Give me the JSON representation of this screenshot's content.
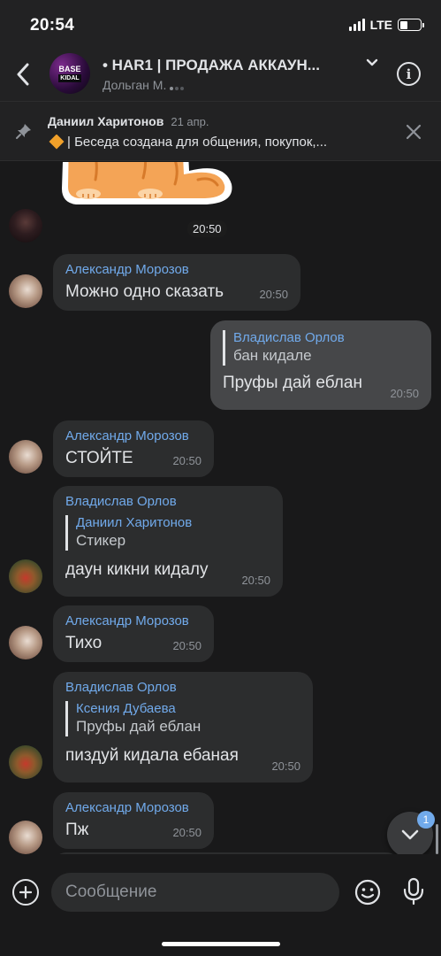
{
  "status_bar": {
    "time": "20:54",
    "network": "LTE",
    "battery_percent": 40
  },
  "header": {
    "avatar_line1": "BASE",
    "avatar_line2": "KIDAL",
    "title": "• HAR1 | ПРОДАЖА АККАУН...",
    "subtitle": "Дольган М."
  },
  "pinned": {
    "author": "Даниил Харитонов",
    "date": "21 апр.",
    "text": "| Беседа создана для общения, покупок,..."
  },
  "sticker": {
    "time": "20:50"
  },
  "messages": [
    {
      "author": "Александр Морозов",
      "text": "Можно одно сказать",
      "time": "20:50"
    },
    {
      "reply_author": "Владислав Орлов",
      "reply_text": "бан кидале",
      "text": "Пруфы дай еблан",
      "time": "20:50"
    },
    {
      "author": "Александр Морозов",
      "text": "СТОЙТЕ",
      "time": "20:50"
    },
    {
      "author": "Владислав Орлов",
      "reply_author": "Даниил Харитонов",
      "reply_text": "Стикер",
      "text": "даун кикни кидалу",
      "time": "20:50"
    },
    {
      "author": "Александр Морозов",
      "text": "Тихо",
      "time": "20:50"
    },
    {
      "author": "Владислав Орлов",
      "reply_author": "Ксения Дубаева",
      "reply_text": "Пруфы дай еблан",
      "text": "пиздуй кидала ебаная",
      "time": "20:50"
    },
    {
      "author": "Александр Морозов",
      "text": "Пж",
      "time": "20:50"
    }
  ],
  "scroll_down": {
    "badge": "1"
  },
  "composer": {
    "placeholder": "Сообщение"
  },
  "colors": {
    "background": "#19191a",
    "bubble_in": "#2c2d2e",
    "bubble_out": "#464749",
    "accent": "#71aaeb"
  }
}
